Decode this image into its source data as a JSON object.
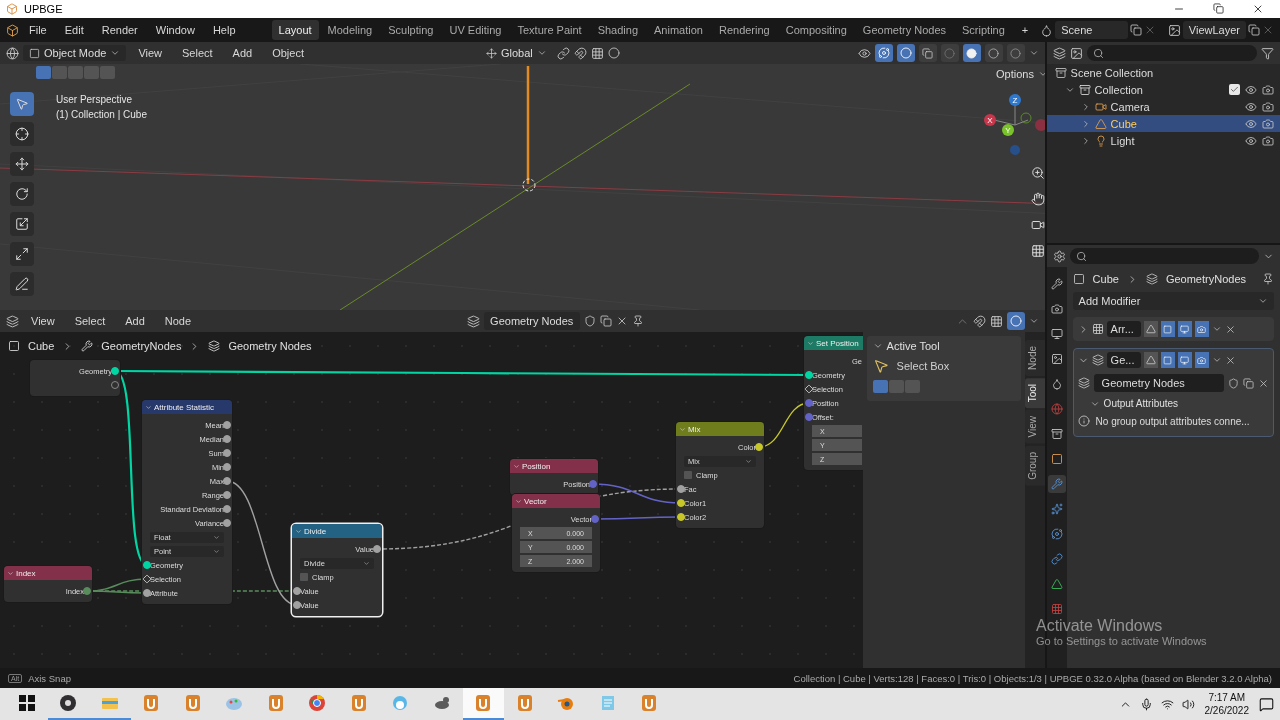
{
  "title_bar": {
    "app_name": "UPBGE"
  },
  "top_bar": {
    "menus": [
      "File",
      "Edit",
      "Render",
      "Window",
      "Help"
    ],
    "workspaces": [
      {
        "label": "Layout",
        "selected": true
      },
      {
        "label": "Modeling",
        "selected": false
      },
      {
        "label": "Sculpting",
        "selected": false
      },
      {
        "label": "UV Editing",
        "selected": false
      },
      {
        "label": "Texture Paint",
        "selected": false
      },
      {
        "label": "Shading",
        "selected": false
      },
      {
        "label": "Animation",
        "selected": false
      },
      {
        "label": "Rendering",
        "selected": false
      },
      {
        "label": "Compositing",
        "selected": false
      },
      {
        "label": "Geometry Nodes",
        "selected": false
      },
      {
        "label": "Scripting",
        "selected": false
      }
    ],
    "add_workspace": "+",
    "scene": "Scene",
    "view_layer": "ViewLayer"
  },
  "viewport": {
    "mode": "Object Mode",
    "menus": [
      "View",
      "Select",
      "Add",
      "Object"
    ],
    "orientation": "Global",
    "options": "Options",
    "info": [
      "User Perspective",
      "(1) Collection | Cube"
    ],
    "tools": [
      {
        "kind": "select",
        "selected": true
      },
      {
        "kind": "cursor",
        "selected": false
      },
      {
        "kind": "move",
        "selected": false
      },
      {
        "kind": "rotate",
        "selected": false
      },
      {
        "kind": "scale",
        "selected": false
      },
      {
        "kind": "transform",
        "selected": false
      },
      {
        "kind": "annotate",
        "selected": false
      }
    ],
    "select_modes": [
      {
        "selected": true
      },
      {
        "selected": false
      },
      {
        "selected": false
      },
      {
        "selected": false
      },
      {
        "selected": false
      }
    ],
    "shading": [
      {
        "kind": "wireframe",
        "selected": false
      },
      {
        "kind": "solid",
        "selected": true
      },
      {
        "kind": "material",
        "selected": false
      },
      {
        "kind": "rendered",
        "selected": false
      }
    ],
    "gizmo": {
      "x": "X",
      "y": "Y",
      "z": "Z"
    }
  },
  "node_editor": {
    "menus": [
      "View",
      "Select",
      "Add",
      "Node"
    ],
    "node_tree": "Geometry Nodes",
    "breadcrumbs": [
      "Cube",
      "GeometryNodes",
      "Geometry Nodes"
    ],
    "nodes": [
      {
        "title": "Index",
        "kind": "input",
        "selected": false,
        "rows": [
          {
            "kind": "output",
            "label": "Index",
            "color": "#598c5c"
          }
        ]
      },
      {
        "selected": false,
        "rows": [
          {
            "kind": "output",
            "label": "Geometry",
            "color": "#00d6a3"
          },
          {
            "kind": "output_empty"
          }
        ]
      },
      {
        "title": "Attribute Statistic",
        "kind": "attribute",
        "selected": false,
        "rows": [
          {
            "kind": "output",
            "label": "Mean",
            "color": "#a1a1a1"
          },
          {
            "kind": "output",
            "label": "Median",
            "color": "#a1a1a1"
          },
          {
            "kind": "output",
            "label": "Sum",
            "color": "#a1a1a1"
          },
          {
            "kind": "output",
            "label": "Min",
            "color": "#a1a1a1"
          },
          {
            "kind": "output",
            "label": "Max",
            "color": "#a1a1a1"
          },
          {
            "kind": "output",
            "label": "Range",
            "color": "#a1a1a1"
          },
          {
            "kind": "output",
            "label": "Standard Deviation",
            "color": "#a1a1a1"
          },
          {
            "kind": "output",
            "label": "Variance",
            "color": "#a1a1a1"
          },
          {
            "kind": "dropdown",
            "label": "Float"
          },
          {
            "kind": "dropdown",
            "label": "Point"
          },
          {
            "kind": "input",
            "label": "Geometry",
            "color": "#00d6a3"
          },
          {
            "kind": "input_diamond",
            "label": "Selection"
          },
          {
            "kind": "input",
            "label": "Attribute",
            "color": "#a1a1a1"
          }
        ]
      },
      {
        "title": "Divide",
        "kind": "math",
        "selected": true,
        "rows": [
          {
            "kind": "output",
            "label": "Value",
            "color": "#a1a1a1"
          },
          {
            "kind": "dropdown",
            "label": "Divide"
          },
          {
            "kind": "checkbox",
            "label": "Clamp",
            "checked": false
          },
          {
            "kind": "input",
            "label": "Value",
            "color": "#a1a1a1"
          },
          {
            "kind": "input",
            "label": "Value",
            "color": "#a1a1a1"
          }
        ]
      },
      {
        "title": "Position",
        "kind": "input",
        "selected": false,
        "rows": [
          {
            "kind": "output",
            "label": "Position",
            "color": "#6363c7"
          }
        ]
      },
      {
        "title": "Vector",
        "kind": "input",
        "selected": false,
        "rows": [
          {
            "kind": "output",
            "label": "Vector",
            "color": "#6363c7"
          },
          {
            "kind": "field",
            "label": "X",
            "value": "0.000"
          },
          {
            "kind": "field",
            "label": "Y",
            "value": "0.000"
          },
          {
            "kind": "field",
            "label": "Z",
            "value": "2.000"
          }
        ]
      },
      {
        "title": "Mix",
        "kind": "color",
        "selected": false,
        "rows": [
          {
            "kind": "output",
            "label": "Color",
            "color": "#c7c729"
          },
          {
            "kind": "dropdown",
            "label": "Mix"
          },
          {
            "kind": "checkbox",
            "label": "Clamp",
            "checked": false
          },
          {
            "kind": "input",
            "label": "Fac",
            "color": "#a1a1a1"
          },
          {
            "kind": "input",
            "label": "Color1",
            "color": "#c7c729"
          },
          {
            "kind": "input",
            "label": "Color2",
            "color": "#c7c729"
          }
        ]
      },
      {
        "title": "Set Position",
        "kind": "geometry",
        "selected": false,
        "rows": [
          {
            "kind": "output",
            "label": "Ge"
          },
          {
            "kind": "input",
            "label": "Geometry",
            "color": "#00d6a3"
          },
          {
            "kind": "input_diamond",
            "label": "Selection"
          },
          {
            "kind": "input",
            "label": "Position",
            "color": "#6363c7"
          },
          {
            "kind": "input",
            "label": "Offset:",
            "color": "#6363c7"
          },
          {
            "kind": "field",
            "label": "X"
          },
          {
            "kind": "field",
            "label": "Y"
          },
          {
            "kind": "field",
            "label": "Z"
          }
        ]
      }
    ],
    "sidebar": {
      "panel": "Active Tool",
      "tool": "Select Box",
      "tabs": [
        {
          "label": "Node",
          "selected": false
        },
        {
          "label": "Tool",
          "selected": true
        },
        {
          "label": "View",
          "selected": false
        },
        {
          "label": "Group",
          "selected": false
        }
      ]
    }
  },
  "outliner": {
    "root": "Scene Collection",
    "items": [
      {
        "label": "Collection",
        "kind": "collection",
        "expanded": true,
        "checked": true,
        "selected": false,
        "children": [
          {
            "label": "Camera",
            "kind": "camera",
            "selected": false
          },
          {
            "label": "Cube",
            "kind": "mesh",
            "selected": true
          },
          {
            "label": "Light",
            "kind": "light",
            "selected": false
          }
        ]
      }
    ]
  },
  "properties": {
    "breadcrumbs": [
      "Cube",
      "GeometryNodes"
    ],
    "add_modifier": "Add Modifier",
    "tabs": [
      {
        "kind": "tool",
        "selected": false
      },
      {
        "kind": "render",
        "selected": false
      },
      {
        "kind": "output",
        "selected": false
      },
      {
        "kind": "view_layer",
        "selected": false
      },
      {
        "kind": "scene",
        "selected": false
      },
      {
        "kind": "world",
        "selected": false
      },
      {
        "kind": "collection",
        "selected": false
      },
      {
        "kind": "object",
        "selected": false
      },
      {
        "kind": "modifier",
        "selected": true
      },
      {
        "kind": "particles",
        "selected": false
      },
      {
        "kind": "physics",
        "selected": false
      },
      {
        "kind": "constraints",
        "selected": false
      },
      {
        "kind": "data",
        "selected": false
      },
      {
        "kind": "texture",
        "selected": false
      }
    ],
    "modifiers": [
      {
        "name": "Arr...",
        "kind": "array",
        "expanded": false
      },
      {
        "name": "Ge...",
        "kind": "nodes",
        "expanded": true,
        "node_group": "Geometry Nodes",
        "section": "Output Attributes",
        "message": "No group output attributes conne..."
      }
    ]
  },
  "status_bar": {
    "key": "Alt",
    "hint": "Axis Snap",
    "stats": "Collection | Cube | Verts:128 | Faces:0 | Tris:0 | Objects:1/3 | UPBGE 0.32.0 Alpha (based on Blender 3.2.0 Alpha)"
  },
  "watermark": {
    "title": "Activate Windows",
    "subtitle": "Go to Settings to activate Windows"
  },
  "taskbar": {
    "apps": [
      {
        "kind": "recorder",
        "running": true
      },
      {
        "kind": "folder",
        "running": true
      },
      {
        "kind": "upbge",
        "running": false
      },
      {
        "kind": "upbge",
        "running": false
      },
      {
        "kind": "palette",
        "running": false
      },
      {
        "kind": "upbge",
        "running": false
      },
      {
        "kind": "browser",
        "running": false
      },
      {
        "kind": "upbge",
        "running": false
      },
      {
        "kind": "bird",
        "running": false
      },
      {
        "kind": "gimp",
        "running": false
      },
      {
        "kind": "upbge",
        "running": true
      },
      {
        "kind": "upbge",
        "running": false
      },
      {
        "kind": "blender",
        "running": false
      },
      {
        "kind": "notes",
        "running": false
      },
      {
        "kind": "upbge",
        "running": false
      }
    ],
    "time": "7:17 AM",
    "date": "2/26/2022"
  }
}
